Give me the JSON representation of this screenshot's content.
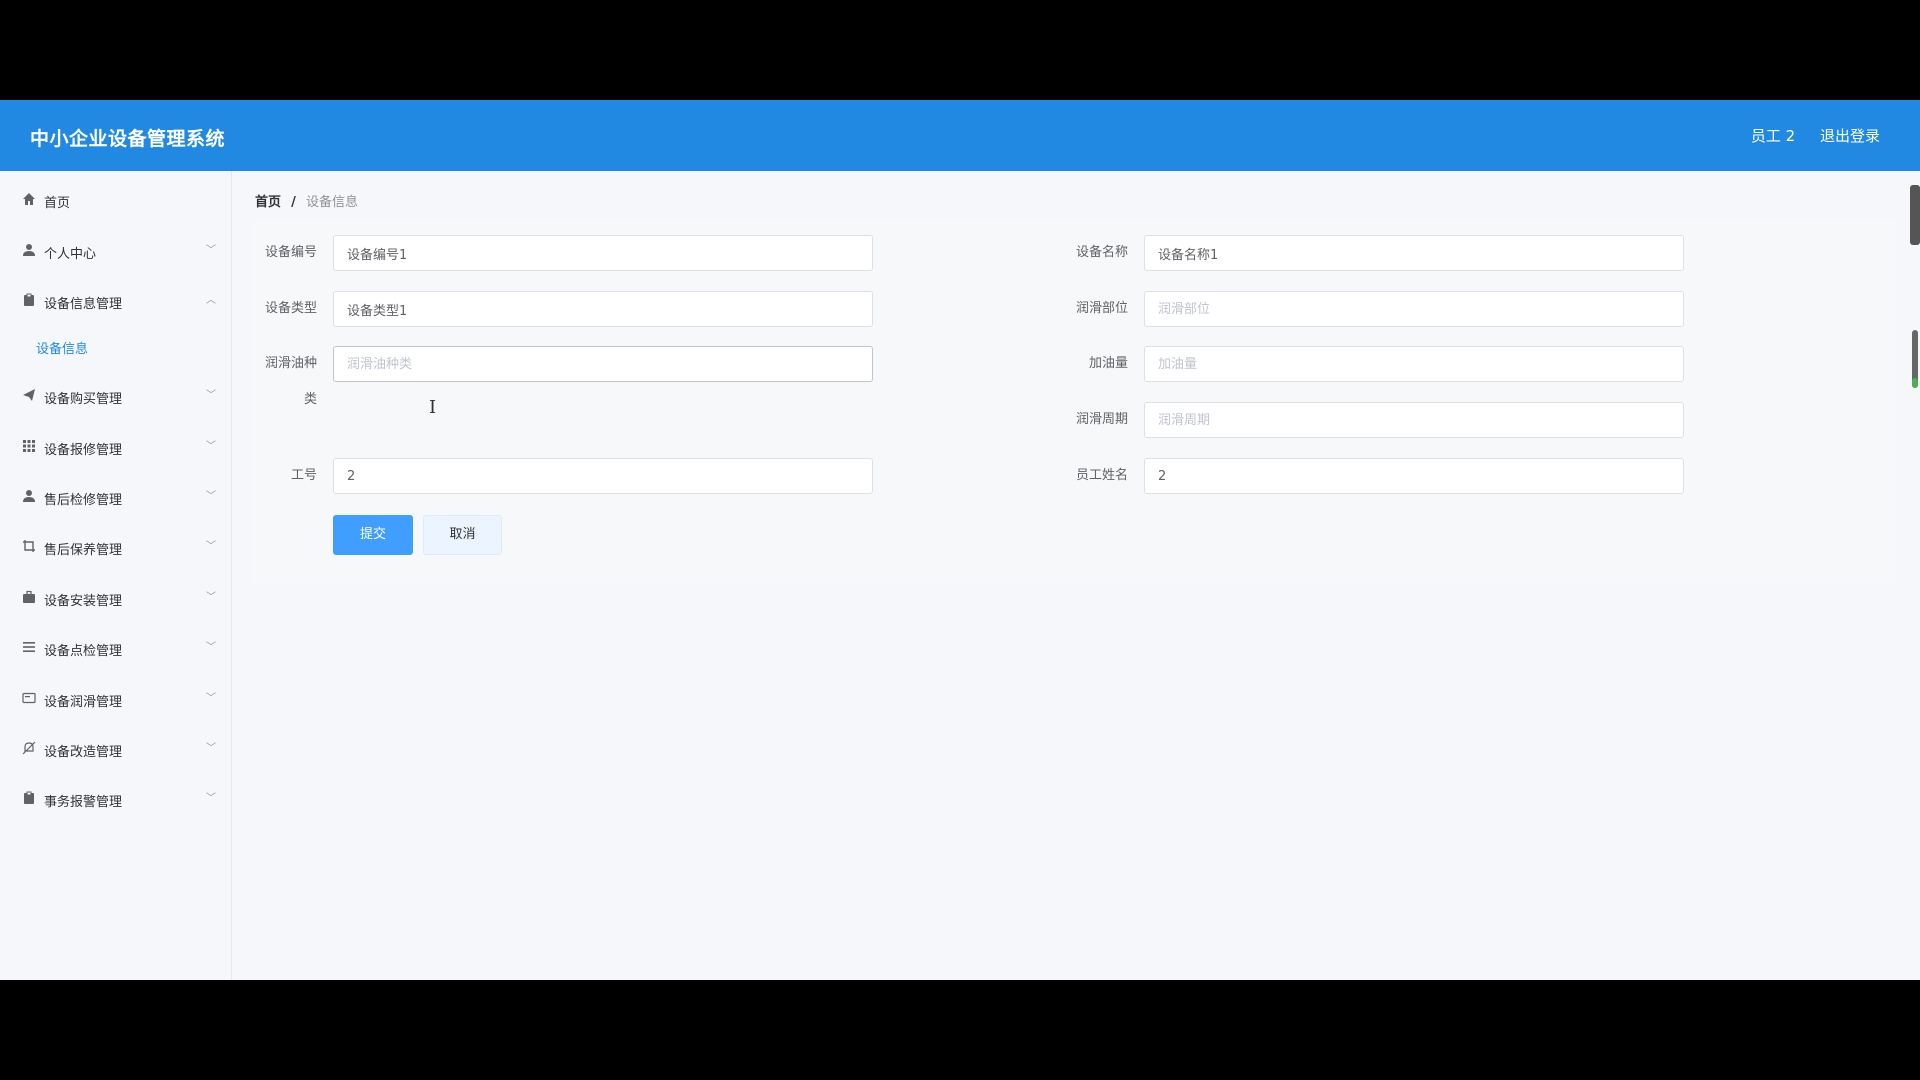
{
  "header": {
    "title": "中小企业设备管理系统",
    "user": "员工 2",
    "logout": "退出登录"
  },
  "sidebar": {
    "items": [
      {
        "label": "首页",
        "icon": "home-icon"
      },
      {
        "label": "个人中心",
        "icon": "user-icon"
      },
      {
        "label": "设备信息管理",
        "icon": "clipboard-icon"
      },
      {
        "label": "设备信息",
        "icon": ""
      },
      {
        "label": "设备购买管理",
        "icon": "send-icon"
      },
      {
        "label": "设备报修管理",
        "icon": "grid-icon"
      },
      {
        "label": "售后检修管理",
        "icon": "user-icon"
      },
      {
        "label": "售后保养管理",
        "icon": "crop-icon"
      },
      {
        "label": "设备安装管理",
        "icon": "briefcase-icon"
      },
      {
        "label": "设备点检管理",
        "icon": "list-icon"
      },
      {
        "label": "设备润滑管理",
        "icon": "card-icon"
      },
      {
        "label": "设备改造管理",
        "icon": "bell-off-icon"
      },
      {
        "label": "事务报警管理",
        "icon": "clipboard-icon"
      }
    ]
  },
  "breadcrumb": {
    "home": "首页",
    "separator": "/",
    "current": "设备信息"
  },
  "form": {
    "device_no": {
      "label": "设备编号",
      "value": "设备编号1",
      "placeholder": "设备编号"
    },
    "device_name": {
      "label": "设备名称",
      "value": "设备名称1",
      "placeholder": "设备名称"
    },
    "device_type": {
      "label": "设备类型",
      "value": "设备类型1",
      "placeholder": "设备类型"
    },
    "lube_part": {
      "label": "润滑部位",
      "value": "",
      "placeholder": "润滑部位"
    },
    "oil_type": {
      "label_line1": "润滑油种",
      "label_line2": "类",
      "value": "",
      "placeholder": "润滑油种类"
    },
    "oil_amount": {
      "label": "加油量",
      "value": "",
      "placeholder": "加油量"
    },
    "lube_cycle": {
      "label": "润滑周期",
      "value": "",
      "placeholder": "润滑周期"
    },
    "emp_no": {
      "label": "工号",
      "value": "2",
      "placeholder": "工号"
    },
    "emp_name": {
      "label": "员工姓名",
      "value": "2",
      "placeholder": "员工姓名"
    }
  },
  "buttons": {
    "submit": "提交",
    "cancel": "取消"
  },
  "colors": {
    "header_bg": "#2289e3",
    "primary": "#409eff",
    "active_menu": "#2289e3"
  }
}
